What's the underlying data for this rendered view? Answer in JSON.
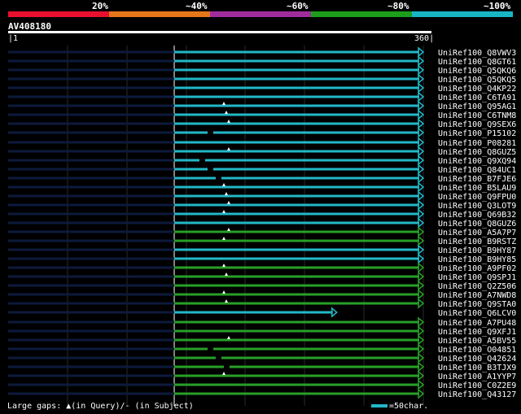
{
  "legend": {
    "colors": [
      "#e8102e",
      "#e5761a",
      "#a02c9c",
      "#1c9e1c",
      "#18b5c4"
    ],
    "labels": [
      "20%",
      "~40%",
      "~60%",
      "~80%",
      "~100%"
    ]
  },
  "query": {
    "id": "AV408180",
    "start": "1",
    "end": "360"
  },
  "track_colors": {
    "cyan": "#22b8c8",
    "green": "#27a027",
    "dark": "#0d1a3c"
  },
  "hits": [
    {
      "name": "UniRef100_Q8VWV3",
      "color": "cyan",
      "end": 360,
      "gap": null
    },
    {
      "name": "UniRef100_Q8GT61",
      "color": "cyan",
      "end": 360,
      "gap": null
    },
    {
      "name": "UniRef100_Q5QKQ6",
      "color": "cyan",
      "end": 360,
      "gap": null
    },
    {
      "name": "UniRef100_Q5QKQ5",
      "color": "cyan",
      "end": 360,
      "gap": null
    },
    {
      "name": "UniRef100_Q4KP22",
      "color": "cyan",
      "end": 360,
      "gap": null
    },
    {
      "name": "UniRef100_C6TA91",
      "color": "cyan",
      "end": 360,
      "gap": null
    },
    {
      "name": "UniRef100_Q95AG1",
      "color": "cyan",
      "end": 360,
      "gap": "query"
    },
    {
      "name": "UniRef100_C6TNM8",
      "color": "cyan",
      "end": 360,
      "gap": "query"
    },
    {
      "name": "UniRef100_Q9SEX6",
      "color": "cyan",
      "end": 360,
      "gap": "query"
    },
    {
      "name": "UniRef100_P15102",
      "color": "cyan",
      "end": 360,
      "gap": "subject"
    },
    {
      "name": "UniRef100_P08281",
      "color": "cyan",
      "end": 360,
      "gap": null
    },
    {
      "name": "UniRef100_Q8GUZ5",
      "color": "cyan",
      "end": 360,
      "gap": "query"
    },
    {
      "name": "UniRef100_Q9XQ94",
      "color": "cyan",
      "end": 360,
      "gap": "subject"
    },
    {
      "name": "UniRef100_Q84UC1",
      "color": "cyan",
      "end": 360,
      "gap": "subject"
    },
    {
      "name": "UniRef100_B7FJE6",
      "color": "cyan",
      "end": 360,
      "gap": "subject"
    },
    {
      "name": "UniRef100_B5LAU9",
      "color": "cyan",
      "end": 360,
      "gap": "query"
    },
    {
      "name": "UniRef100_Q9FPU0",
      "color": "cyan",
      "end": 360,
      "gap": "query"
    },
    {
      "name": "UniRef100_Q3LOT9",
      "color": "cyan",
      "end": 360,
      "gap": "query"
    },
    {
      "name": "UniRef100_Q69B32",
      "color": "cyan",
      "end": 360,
      "gap": "query"
    },
    {
      "name": "UniRef100_Q8GUZ6",
      "color": "cyan",
      "end": 360,
      "gap": null
    },
    {
      "name": "UniRef100_A5A7P7",
      "color": "green",
      "end": 360,
      "gap": "query"
    },
    {
      "name": "UniRef100_B9RSTZ",
      "color": "green",
      "end": 360,
      "gap": "query"
    },
    {
      "name": "UniRef100_B9HY87",
      "color": "cyan",
      "end": 360,
      "gap": null
    },
    {
      "name": "UniRef100_B9HY85",
      "color": "cyan",
      "end": 360,
      "gap": null
    },
    {
      "name": "UniRef100_A9PF02",
      "color": "green",
      "end": 360,
      "gap": "query"
    },
    {
      "name": "UniRef100_Q9SPJ1",
      "color": "green",
      "end": 360,
      "gap": "query"
    },
    {
      "name": "UniRef100_Q2Z506",
      "color": "green",
      "end": 360,
      "gap": null
    },
    {
      "name": "UniRef100_A7NWD8",
      "color": "green",
      "end": 360,
      "gap": "query"
    },
    {
      "name": "UniRef100_Q9STA0",
      "color": "green",
      "end": 360,
      "gap": "query"
    },
    {
      "name": "UniRef100_Q6LCV0",
      "color": "cyan",
      "end": 285,
      "gap": null
    },
    {
      "name": "UniRef100_A7PU48",
      "color": "green",
      "end": 360,
      "gap": null
    },
    {
      "name": "UniRef100_Q9XFJ1",
      "color": "green",
      "end": 360,
      "gap": null
    },
    {
      "name": "UniRef100_A5BV55",
      "color": "green",
      "end": 360,
      "gap": "query"
    },
    {
      "name": "UniRef100_O04851",
      "color": "green",
      "end": 360,
      "gap": "subject"
    },
    {
      "name": "UniRef100_Q42624",
      "color": "green",
      "end": 360,
      "gap": "subject"
    },
    {
      "name": "UniRef100_B3TJX9",
      "color": "green",
      "end": 360,
      "gap": "subject"
    },
    {
      "name": "UniRef100_A1YYP7",
      "color": "green",
      "end": 360,
      "gap": "query"
    },
    {
      "name": "UniRef100_C0Z2E9",
      "color": "green",
      "end": 360,
      "gap": null
    },
    {
      "name": "UniRef100_Q43127",
      "color": "green",
      "end": 360,
      "gap": null
    }
  ],
  "footer": {
    "gaps_text": "Large gaps: ▲(in Query)/- (in Subject)",
    "key_text": "=50char."
  }
}
